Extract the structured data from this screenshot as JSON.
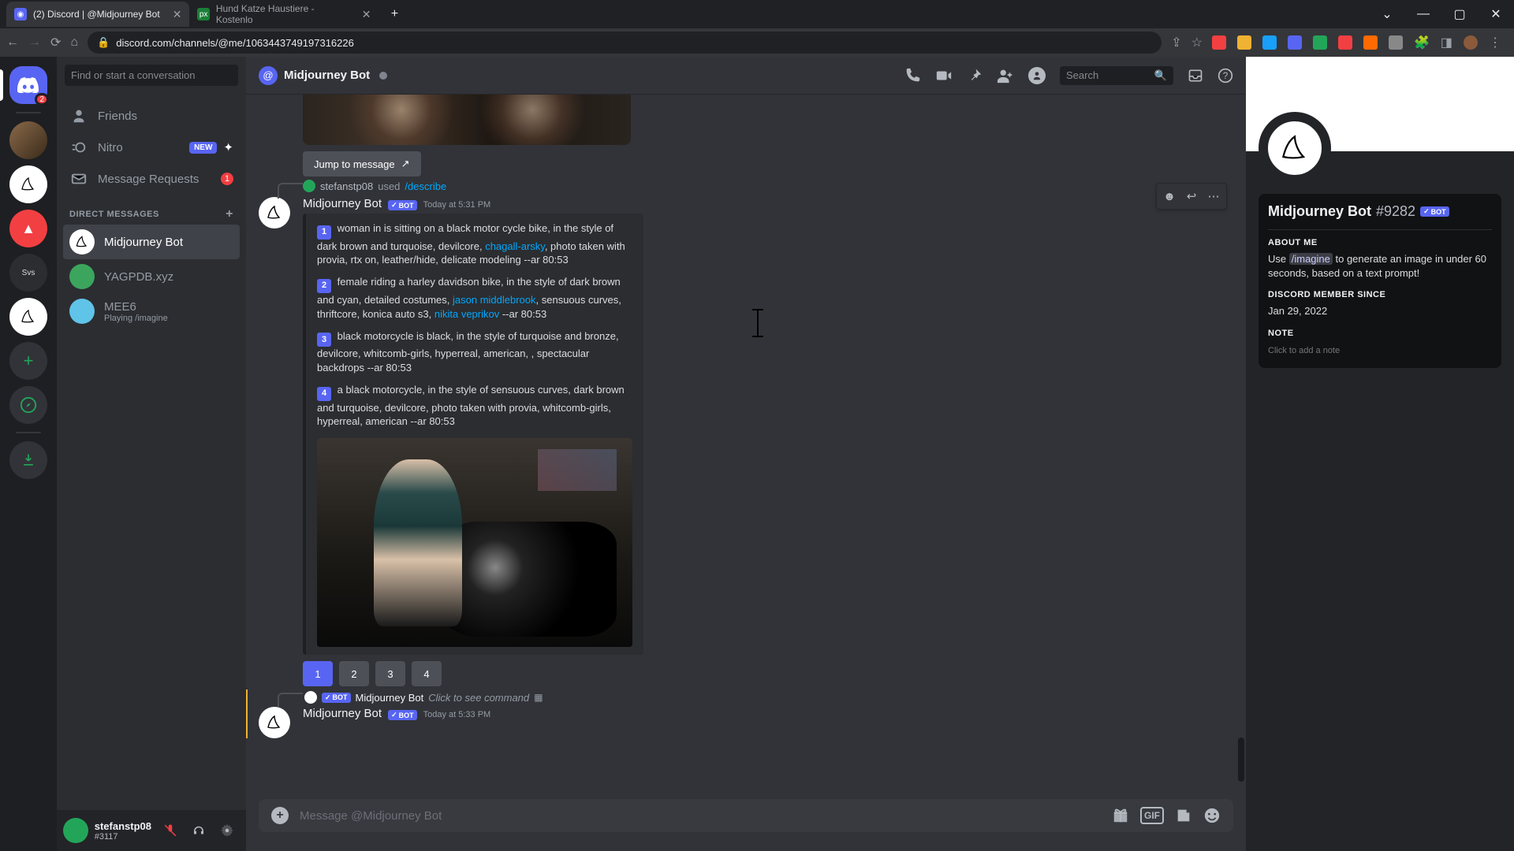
{
  "browser": {
    "tabs": [
      {
        "title": "(2) Discord | @Midjourney Bot",
        "active": true,
        "favicon_bg": "#5865f2"
      },
      {
        "title": "Hund Katze Haustiere - Kostenlo",
        "active": false,
        "favicon_bg": "#1a7f37"
      }
    ],
    "url": "discord.com/channels/@me/1063443749197316226",
    "ext_colors": [
      "#f23f42",
      "#f0b232",
      "#18a0fb",
      "#5865f2",
      "#23a559",
      "#f23f42",
      "#ff6a00",
      "#888888",
      "#f0b232"
    ]
  },
  "guild_col": {
    "home_badge": "2",
    "svs_label": "Svs"
  },
  "dm": {
    "search_placeholder": "Find or start a conversation",
    "nav": {
      "friends": "Friends",
      "nitro": "Nitro",
      "nitro_badge": "NEW",
      "requests": "Message Requests",
      "requests_badge": "1"
    },
    "heading": "DIRECT MESSAGES",
    "items": [
      {
        "name": "Midjourney Bot",
        "selected": true,
        "avatar_bg": "#ffffff"
      },
      {
        "name": "YAGPDB.xyz",
        "selected": false,
        "avatar_bg": "#3ba55d"
      },
      {
        "name": "MEE6",
        "selected": false,
        "avatar_bg": "#60c3e8",
        "status": "Playing /imagine"
      }
    ],
    "user_panel": {
      "name": "stefanstp08",
      "tag": "#3117"
    }
  },
  "chat": {
    "header_title": "Midjourney Bot",
    "search_placeholder": "Search",
    "jump_label": "Jump to message",
    "reply": {
      "user": "stefanstp08",
      "action": "used",
      "command": "/describe"
    },
    "msg1": {
      "author": "Midjourney Bot",
      "bot_label": "BOT",
      "time": "Today at 5:31 PM",
      "d1a": " woman in is sitting on a black motor cycle bike, in the style of dark brown and turquoise, devilcore, ",
      "d1_link": "chagall-arsky",
      "d1b": ", photo taken with provia, rtx on, leather/hide, delicate modeling --ar 80:53",
      "d2a": " female riding a harley davidson bike, in the style of dark brown and cyan, detailed costumes, ",
      "d2_link": "jason middlebrook",
      "d2b": ", sensuous curves, thriftcore, konica auto s3, ",
      "d2_link2": "nikita veprikov",
      "d2c": " --ar 80:53",
      "d3": " black motorcycle is black, in the style of turquoise and bronze, devilcore, whitcomb-girls, hyperreal, american, , spectacular backdrops --ar 80:53",
      "d4": " a black motorcycle, in the style of sensuous curves, dark brown and turquoise, devilcore, photo taken with provia, whitcomb-girls, hyperreal, american --ar 80:53",
      "buttons": [
        "1",
        "2",
        "3",
        "4"
      ]
    },
    "msg2": {
      "reply_author": "Midjourney Bot",
      "reply_text": "Click to see command",
      "author": "Midjourney Bot",
      "bot_label": "BOT",
      "time": "Today at 5:33 PM"
    },
    "composer_placeholder": "Message @Midjourney Bot"
  },
  "profile": {
    "name": "Midjourney Bot",
    "discrim": "#9282",
    "bot_label": "BOT",
    "about_title": "ABOUT ME",
    "about_pre": "Use ",
    "about_cmd": "/imagine",
    "about_post": " to generate an image in under 60 seconds, based on a text prompt!",
    "member_title": "DISCORD MEMBER SINCE",
    "member_date": "Jan 29, 2022",
    "note_title": "NOTE",
    "note_placeholder": "Click to add a note"
  }
}
